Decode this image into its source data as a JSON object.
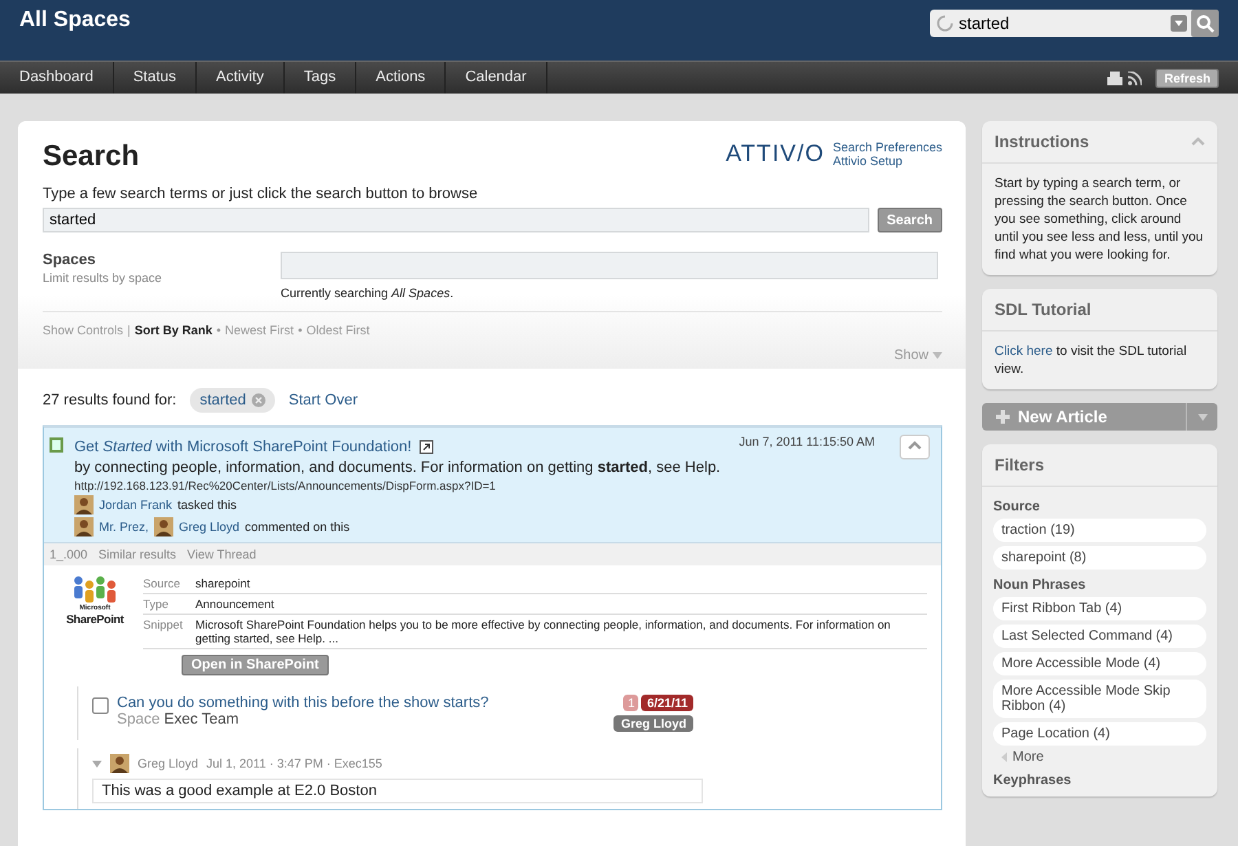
{
  "header": {
    "title": "All Spaces",
    "search_value": "started"
  },
  "nav": {
    "tabs": [
      {
        "label": "Dashboard",
        "selected": false
      },
      {
        "label": "Status",
        "selected": false
      },
      {
        "label": "Activity",
        "selected": false
      },
      {
        "label": "Tags",
        "selected": false
      },
      {
        "label": "Actions",
        "selected": false
      },
      {
        "label": "Calendar",
        "selected": false
      }
    ],
    "refresh": "Refresh"
  },
  "search": {
    "title": "Search",
    "brand": "ATTIV/O",
    "links": [
      "Search Preferences",
      "Attivio Setup"
    ],
    "prompt": "Type a few search terms or just click the search button to browse",
    "query": "started",
    "button": "Search",
    "spaces_label": "Spaces",
    "spaces_hint": "Limit results by space",
    "current": "Currently searching *All Spaces*.",
    "show_controls": "Show Controls",
    "separator": "|",
    "bullet": "•",
    "sort_options": [
      {
        "label": "Sort By Rank",
        "selected": true
      },
      {
        "label": "Newest First",
        "selected": false
      },
      {
        "label": "Oldest First",
        "selected": false
      }
    ],
    "show": "Show"
  },
  "results": {
    "count": "27 results found for:",
    "term": "started",
    "start_over": "Start Over"
  },
  "result": {
    "title": "Get *Started* with Microsoft SharePoint Foundation!",
    "date": "Jun 7, 2011 11:15:50 AM",
    "snippet": "by connecting people, information, and documents. For information on getting **started**, see Help.",
    "url": "http://192.168.123.91/Rec%20Center/Lists/Announcements/DispForm.aspx?ID=1",
    "activity": [
      {
        "people": [
          "Jordan Frank"
        ],
        "text": "tasked this"
      },
      {
        "people": [
          "Mr. Prez,",
          "Greg Lloyd"
        ],
        "text": "commented on this"
      }
    ],
    "actions": [
      "1_.000",
      "Similar results",
      "View Thread"
    ],
    "logo": [
      "Microsoft",
      "SharePoint"
    ],
    "fields": [
      {
        "label": "Source",
        "value": "sharepoint"
      },
      {
        "label": "Type",
        "value": "Announcement"
      },
      {
        "label": "Snippet",
        "value": "Microsoft SharePoint Foundation helps you to be more effective by connecting people, information, and documents. For information on getting started, see Help. ..."
      }
    ],
    "open_button": "Open in SharePoint",
    "task": {
      "checked": false,
      "title": "Can you do something with this before the show starts?",
      "space_label": "Space",
      "space": "Exec Team",
      "count": "1",
      "date": "6/21/11",
      "assignee": "Greg Lloyd"
    },
    "comment": {
      "author": "Greg Lloyd",
      "meta": "Jul 1, 2011 · 3:47 PM · Exec155",
      "text": "This was a good example at E2.0 Boston"
    }
  },
  "sidebar": {
    "instructions": {
      "title": "Instructions",
      "expanded": true,
      "text": "Start by typing a search term, or pressing the search button. Once you see something, click around until you see less and less, until you find what you were looking for."
    },
    "tutorial": {
      "title": "SDL Tutorial",
      "link": "Click here",
      "text": " to visit the SDL tutorial view."
    },
    "new_article": "New Article",
    "filters": {
      "title": "Filters",
      "groups": [
        {
          "heading": "Source",
          "items": [
            "traction (19)",
            "sharepoint (8)"
          ]
        },
        {
          "heading": "Noun Phrases",
          "items": [
            "First Ribbon Tab (4)",
            "Last Selected Command (4)",
            "More Accessible Mode (4)",
            "More Accessible Mode Skip Ribbon (4)",
            "Page Location (4)"
          ],
          "more": "More"
        },
        {
          "heading": "Keyphrases"
        }
      ]
    }
  }
}
